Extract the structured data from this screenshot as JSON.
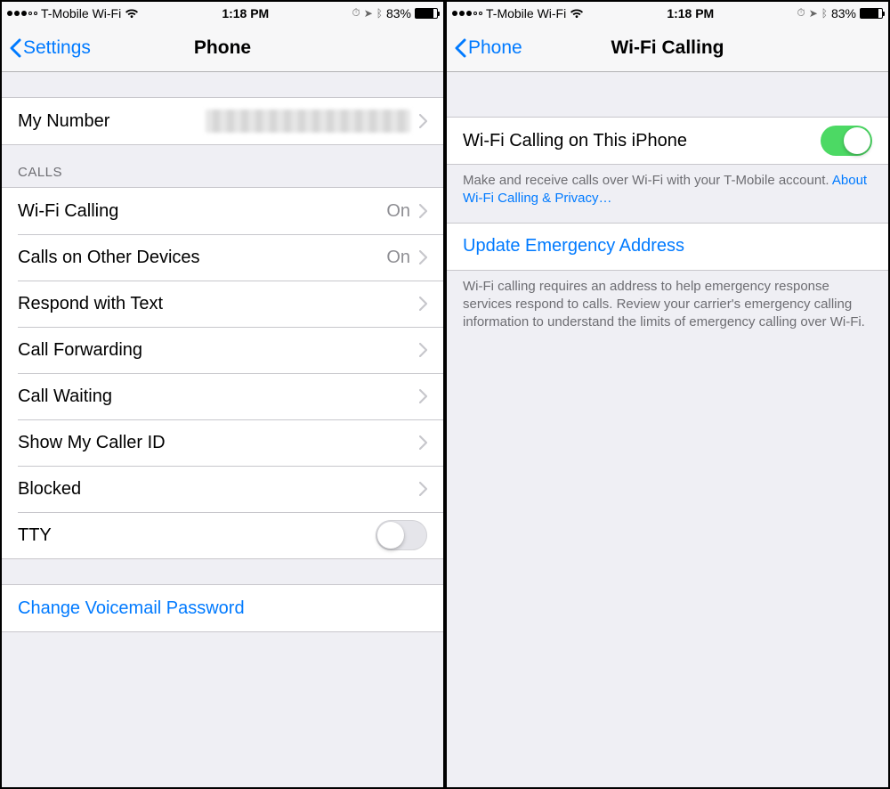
{
  "status": {
    "carrier": "T-Mobile Wi-Fi",
    "time": "1:18 PM",
    "battery_pct": "83%"
  },
  "left": {
    "back_label": "Settings",
    "title": "Phone",
    "my_number_label": "My Number",
    "calls_header": "CALLS",
    "rows": {
      "wifi_calling": {
        "label": "Wi-Fi Calling",
        "detail": "On"
      },
      "other_devices": {
        "label": "Calls on Other Devices",
        "detail": "On"
      },
      "respond_text": {
        "label": "Respond with Text"
      },
      "call_forwarding": {
        "label": "Call Forwarding"
      },
      "call_waiting": {
        "label": "Call Waiting"
      },
      "caller_id": {
        "label": "Show My Caller ID"
      },
      "blocked": {
        "label": "Blocked"
      },
      "tty": {
        "label": "TTY",
        "on": false
      }
    },
    "change_vm": "Change Voicemail Password"
  },
  "right": {
    "back_label": "Phone",
    "title": "Wi-Fi Calling",
    "toggle_label": "Wi-Fi Calling on This iPhone",
    "toggle_on": true,
    "footer1_text": "Make and receive calls over Wi-Fi with your T-Mobile account. ",
    "footer1_link": "About Wi-Fi Calling & Privacy…",
    "update_addr": "Update Emergency Address",
    "footer2": "Wi-Fi calling requires an address to help emergency response services respond to calls. Review your carrier's emergency calling information to understand the limits of emergency calling over Wi-Fi."
  }
}
